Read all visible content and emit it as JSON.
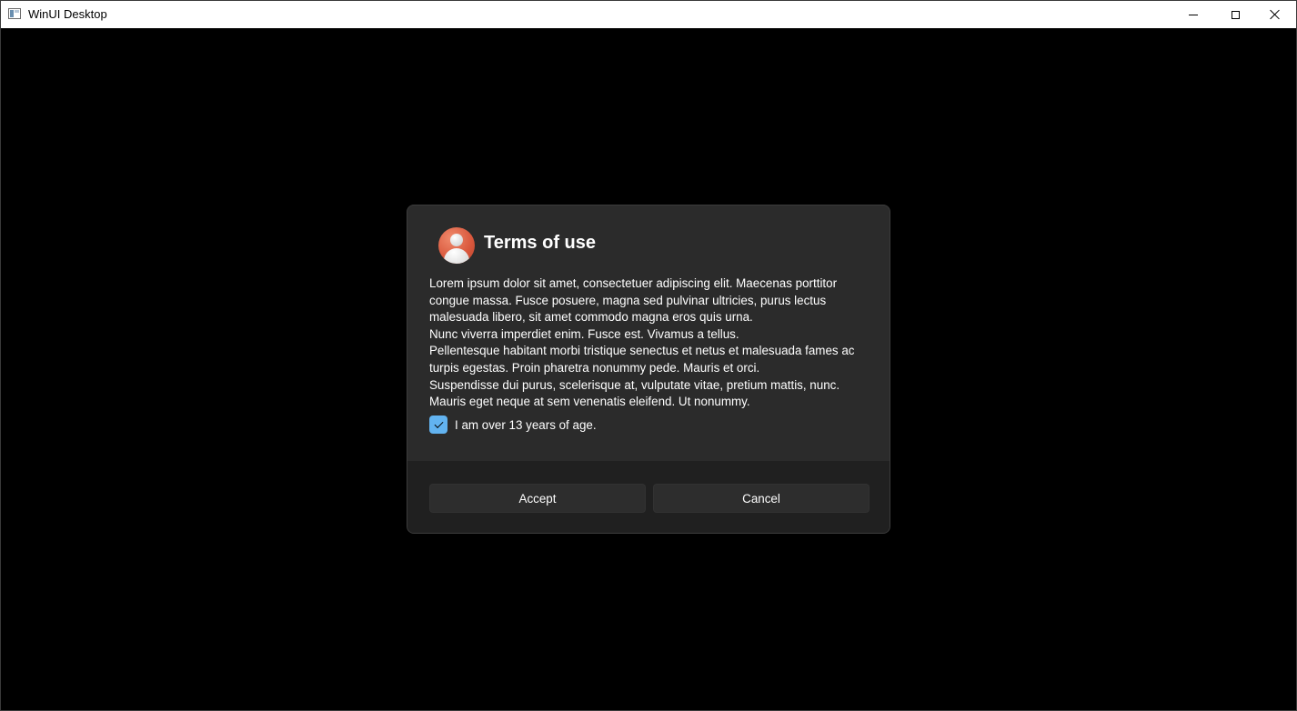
{
  "window": {
    "title": "WinUI Desktop",
    "icon": "app-window-icon",
    "controls": [
      "minimize-icon",
      "maximize-icon",
      "close-icon"
    ]
  },
  "dialog": {
    "avatar_icon": "user-avatar-icon",
    "title": "Terms of use",
    "body_lines": [
      "Lorem ipsum dolor sit amet, consectetuer adipiscing elit. Maecenas porttitor",
      "congue massa. Fusce posuere, magna sed pulvinar ultricies, purus lectus",
      "malesuada libero, sit amet commodo magna eros quis urna.",
      "Nunc viverra imperdiet enim. Fusce est. Vivamus a tellus.",
      "Pellentesque habitant morbi tristique senectus et netus et malesuada fames ac",
      "turpis egestas. Proin pharetra nonummy pede. Mauris et orci.",
      "Suspendisse dui purus, scelerisque at, vulputate vitae, pretium mattis, nunc.",
      "Mauris eget neque at sem venenatis eleifend. Ut nonummy."
    ],
    "checkbox": {
      "label": "I am over 13 years of age.",
      "checked": true
    },
    "primary_button": "Accept",
    "secondary_button": "Cancel"
  },
  "colors": {
    "window_background": "#000000",
    "dialog_background": "#2b2b2b",
    "footer_background": "#202020",
    "accent": "#62b3f0"
  }
}
